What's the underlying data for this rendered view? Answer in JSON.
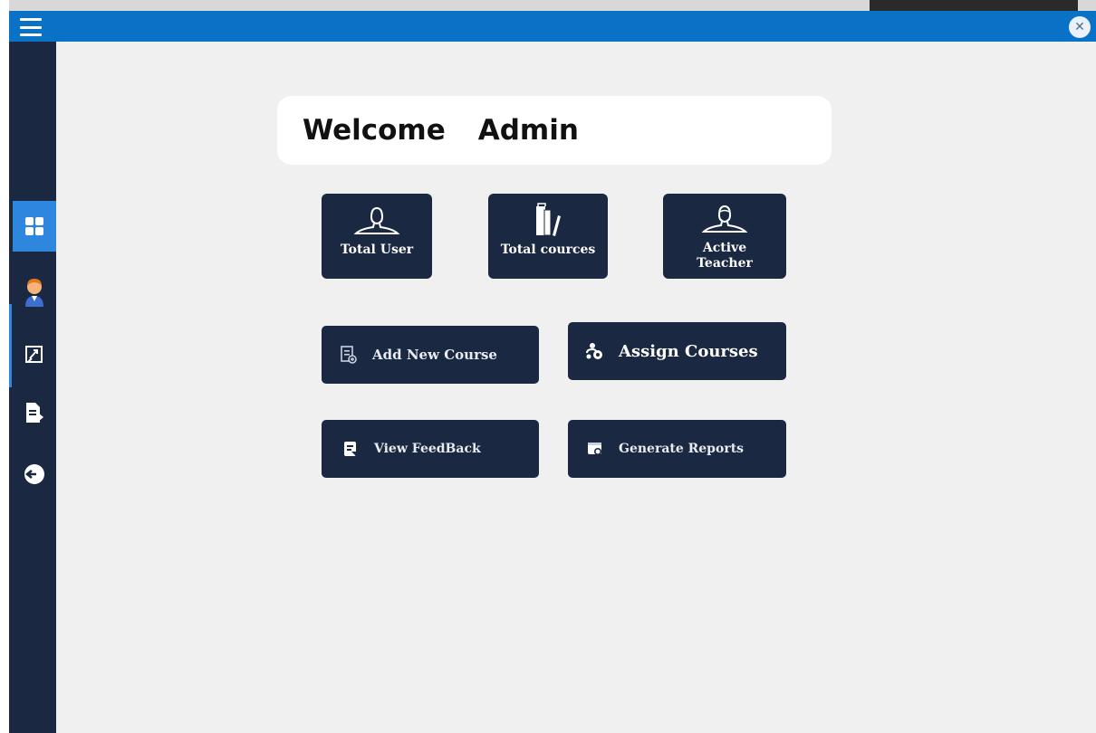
{
  "colors": {
    "titlebar": "#0a72c6",
    "sidebar": "#1b2841",
    "sidebar_active": "#2e86de",
    "card": "#1b2841",
    "background": "#f0f0f0"
  },
  "titlebar": {
    "menu_icon": "hamburger-menu-icon",
    "close_icon": "close-icon",
    "close_symbol": "✕"
  },
  "sidebar": {
    "items": [
      {
        "id": "dashboard",
        "icon": "dashboard-grid-icon",
        "active": true
      },
      {
        "id": "users",
        "icon": "user-avatar-icon",
        "active": false
      },
      {
        "id": "courses",
        "icon": "course-edit-icon",
        "active": false
      },
      {
        "id": "documents",
        "icon": "document-icon",
        "active": false
      },
      {
        "id": "logout",
        "icon": "logout-icon",
        "active": false
      }
    ]
  },
  "main": {
    "welcome_word": "Welcome",
    "welcome_name": "Admin",
    "stats": [
      {
        "label": "Total User",
        "icon": "user-outline-icon"
      },
      {
        "label": "Total cources",
        "icon": "books-icon"
      },
      {
        "label_line1": "Active",
        "label_line2": "Teacher",
        "icon": "teacher-outline-icon"
      }
    ],
    "actions": {
      "add_course": "Add New Course",
      "assign_courses": "Assign Courses",
      "view_feedback": "View FeedBack",
      "generate_reports": "Generate Reports"
    }
  }
}
